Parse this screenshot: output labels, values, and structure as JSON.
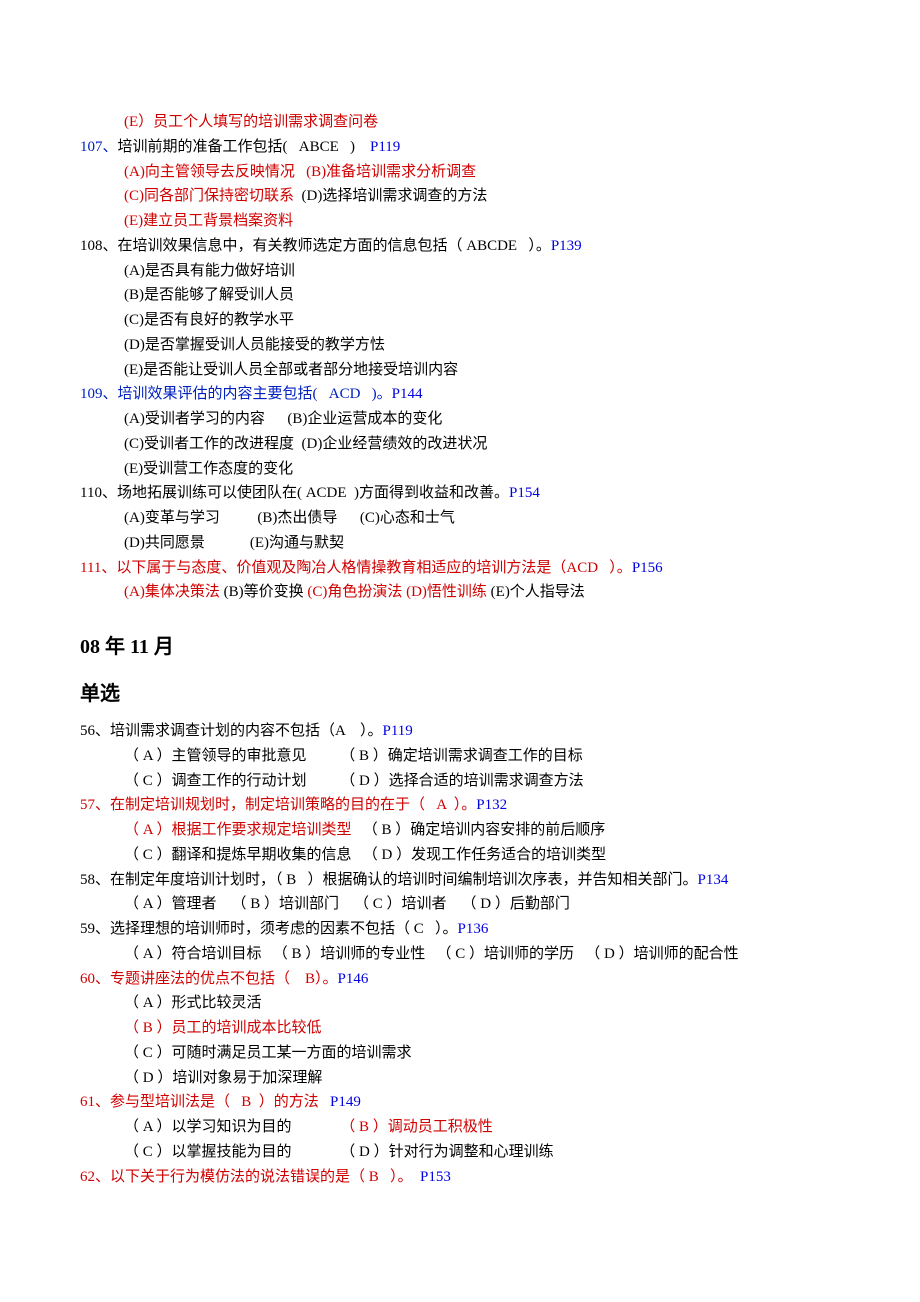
{
  "lines": [
    {
      "indent": 1,
      "spans": [
        {
          "text": "(E）员工个人填写的培训需求调查问卷",
          "cls": "red"
        }
      ]
    },
    {
      "indent": 0,
      "spans": [
        {
          "text": "107、",
          "cls": "blue-q"
        },
        {
          "text": "培训前期的准备工作包括(   ABCE   )    "
        },
        {
          "text": "P119",
          "cls": "blue"
        }
      ]
    },
    {
      "indent": 1,
      "spans": [
        {
          "text": "(A)向主管领导去反映情况   (B)准备培训需求分析调查",
          "cls": "red"
        }
      ]
    },
    {
      "indent": 1,
      "spans": [
        {
          "text": "(C)同各部门保持密切联系",
          "cls": "red"
        },
        {
          "text": "  (D)选择培训需求调查的方法"
        }
      ]
    },
    {
      "indent": 1,
      "spans": [
        {
          "text": "(E)建立员工背景档案资料",
          "cls": "red"
        }
      ]
    },
    {
      "indent": 0,
      "spans": [
        {
          "text": "108、在培训效果信息中，有关教师选定方面的信息包括（ ABCDE   ）。"
        },
        {
          "text": "P139",
          "cls": "blue"
        }
      ]
    },
    {
      "indent": 1,
      "spans": [
        {
          "text": "(A)是否具有能力做好培训"
        }
      ]
    },
    {
      "indent": 1,
      "spans": [
        {
          "text": "(B)是否能够了解受训人员"
        }
      ]
    },
    {
      "indent": 1,
      "spans": [
        {
          "text": "(C)是否有良好的教学水平"
        }
      ]
    },
    {
      "indent": 1,
      "spans": [
        {
          "text": "(D)是否掌握受训人员能接受的教学方怯"
        }
      ]
    },
    {
      "indent": 1,
      "spans": [
        {
          "text": "(E)是否能让受训人员全部或者部分地接受培训内容"
        }
      ]
    },
    {
      "indent": 0,
      "spans": [
        {
          "text": "109、培训效果评估的内容主要包括(   ACD   )。",
          "cls": "blue-q"
        },
        {
          "text": "P144",
          "cls": "blue"
        }
      ]
    },
    {
      "indent": 1,
      "spans": [
        {
          "text": "(A)受训者学习的内容      (B)企业运营成本的变化"
        }
      ]
    },
    {
      "indent": 1,
      "spans": [
        {
          "text": "(C)受训者工作的改进程度  (D)企业经营绩效的改进状况"
        }
      ]
    },
    {
      "indent": 1,
      "spans": [
        {
          "text": "(E)受训营工作态度的变化"
        }
      ]
    },
    {
      "indent": 0,
      "spans": [
        {
          "text": "110、场地拓展训练可以使团队在( ACDE  )方面得到收益和改善。"
        },
        {
          "text": "P154",
          "cls": "blue"
        }
      ]
    },
    {
      "indent": 1,
      "spans": [
        {
          "text": "(A)变革与学习          (B)杰出债导      (C)心态和士气"
        }
      ]
    },
    {
      "indent": 1,
      "spans": [
        {
          "text": "(D)共同愿景            (E)沟通与默契"
        }
      ]
    },
    {
      "indent": 0,
      "spans": [
        {
          "text": "111、以下属于与态度、价值观及陶冶人格情操教育相适应的培训方法是（ACD   ）。",
          "cls": "red"
        },
        {
          "text": "P156",
          "cls": "blue"
        }
      ]
    },
    {
      "indent": 1,
      "spans": [
        {
          "text": "(A)集体决策法 ",
          "cls": "red"
        },
        {
          "text": "(B)等价变换 "
        },
        {
          "text": "(C)角色扮演法 (D)悟性训练 ",
          "cls": "red"
        },
        {
          "text": "(E)个人指导法"
        }
      ]
    }
  ],
  "heading1": "08 年 11 月",
  "heading2": "单选",
  "lines2": [
    {
      "indent": 0,
      "spans": [
        {
          "text": "56、培训需求调查计划的内容不包括（A    ）。"
        },
        {
          "text": "P119",
          "cls": "blue"
        }
      ]
    },
    {
      "indent": 1,
      "spans": [
        {
          "text": "（ A ）主管领导的审批意见         （ B ）确定培训需求调查工作的目标"
        }
      ]
    },
    {
      "indent": 1,
      "spans": [
        {
          "text": "（ C ）调查工作的行动计划         （ D ）选择合适的培训需求调查方法"
        }
      ]
    },
    {
      "indent": 0,
      "spans": [
        {
          "text": "57、在制定培训规划时，制定培训策略的目的在于（   A  ）。",
          "cls": "red"
        },
        {
          "text": "P132",
          "cls": "blue"
        }
      ]
    },
    {
      "indent": 1,
      "spans": [
        {
          "text": "（ A ）根据工作要求规定培训类型",
          "cls": "red"
        },
        {
          "text": "   （ B ）确定培训内容安排的前后顺序"
        }
      ]
    },
    {
      "indent": 1,
      "spans": [
        {
          "text": "（ C ）翻译和提炼早期收集的信息   （ D ）发现工作任务适合的培训类型"
        }
      ]
    },
    {
      "indent": 0,
      "spans": [
        {
          "text": "58、在制定年度培训计划时，（ B   ）根据确认的培训时间编制培训次序表，并告知相关部门。"
        },
        {
          "text": "P134",
          "cls": "blue"
        }
      ]
    },
    {
      "indent": 1,
      "spans": [
        {
          "text": "（ A ）管理者    （ B ）培训部门    （ C ）培训者    （ D ）后勤部门"
        }
      ]
    },
    {
      "indent": 0,
      "spans": [
        {
          "text": "59、选择理想的培训师时，须考虑的因素不包括（ C   ）。"
        },
        {
          "text": "P136",
          "cls": "blue"
        }
      ]
    },
    {
      "indent": 1,
      "spans": [
        {
          "text": "（ A ）符合培训目标   （ B ）培训师的专业性   （ C ）培训师的学历   （ D ）培训师的配合性"
        }
      ]
    },
    {
      "indent": 0,
      "spans": [
        {
          "text": "60、专题讲座法的优点不包括（    B）。",
          "cls": "red"
        },
        {
          "text": "P146",
          "cls": "blue"
        }
      ]
    },
    {
      "indent": 1,
      "spans": [
        {
          "text": "（ A ）形式比较灵活"
        }
      ]
    },
    {
      "indent": 1,
      "spans": [
        {
          "text": "（ B ）员工的培训成本比较低",
          "cls": "red"
        }
      ]
    },
    {
      "indent": 1,
      "spans": [
        {
          "text": "（ C ）可随时满足员工某一方面的培训需求"
        }
      ]
    },
    {
      "indent": 1,
      "spans": [
        {
          "text": "（ D ）培训对象易于加深理解"
        }
      ]
    },
    {
      "indent": 0,
      "spans": [
        {
          "text": "61、参与型培训法是（   B  ）的方法   ",
          "cls": "red"
        },
        {
          "text": "P149",
          "cls": "blue"
        }
      ]
    },
    {
      "indent": 1,
      "spans": [
        {
          "text": "（ A ）以学习知识为目的             "
        },
        {
          "text": "（ B ）调动员工积极性",
          "cls": "red"
        }
      ]
    },
    {
      "indent": 1,
      "spans": [
        {
          "text": "（ C ）以掌握技能为目的             （ D ）针对行为调整和心理训练"
        }
      ]
    },
    {
      "indent": 0,
      "spans": [
        {
          "text": "62、以下关于行为模仿法的说法错误的是（ B   ）。  ",
          "cls": "red"
        },
        {
          "text": "P153",
          "cls": "blue"
        }
      ]
    }
  ]
}
